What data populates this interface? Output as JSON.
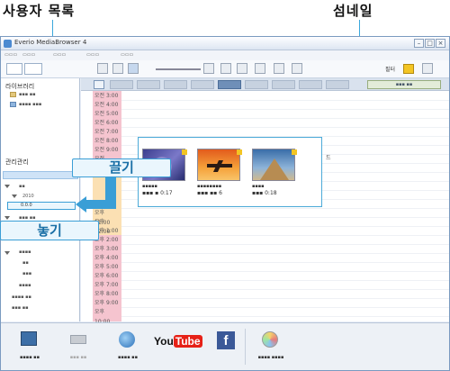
{
  "callouts": {
    "user_list": "사용자 목록",
    "thumbnail": "섬네일"
  },
  "window": {
    "title": "Everio MediaBrowser 4",
    "controls": [
      "–",
      "□",
      "×"
    ]
  },
  "sidebar": {
    "library_heading": "라이브러리",
    "management_heading": "관리관리"
  },
  "toolbar": {
    "filter_label": "필터"
  },
  "times": [
    "오전 3:00",
    "오전 4:00",
    "오전 5:00",
    "오전 6:00",
    "오전 7:00",
    "오전 8:00",
    "오전 9:00",
    "오전 10:00",
    "",
    "",
    "",
    "",
    "",
    "오후 11:00",
    "오후 12:00",
    "오후 1:00",
    "오후 2:00",
    "오후 3:00",
    "오후 4:00",
    "오후 5:00",
    "오후 6:00",
    "오후 7:00",
    "오후 8:00",
    "오후 9:00",
    "오후 10:00",
    "오후 11:00"
  ],
  "drag_label": "끌기",
  "drop_label": "놓기",
  "drop_target": "0.0.0",
  "side_text": "드",
  "bottom_bar": {
    "youtube": "YouTube",
    "facebook": "f"
  },
  "colors": {
    "accent_blue": "#3a9ed6",
    "morning_pink": "#f5c4cf",
    "day_orange": "#fbe0b3",
    "youtube_red": "#e62117",
    "facebook_blue": "#3b5998"
  },
  "icons": [
    "window-icon",
    "folder-icon",
    "thumbnail-sky-icon",
    "thumbnail-plane-icon",
    "thumbnail-pyramid-icon",
    "video-icon",
    "phone-icon",
    "globe-icon",
    "youtube-logo",
    "facebook-logo",
    "disc-icon"
  ]
}
